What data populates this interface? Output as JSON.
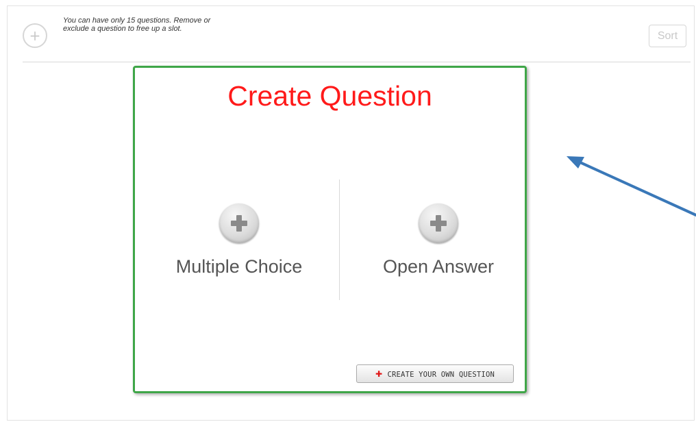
{
  "top_bar": {
    "add_icon": "plus-icon",
    "limit_message": "You can have only 15 questions. Remove or exclude a question to free up a slot.",
    "sort_label": "Sort"
  },
  "create_panel": {
    "title": "Create Question",
    "options": [
      {
        "label": "Multiple Choice",
        "icon": "plus-icon"
      },
      {
        "label": "Open Answer",
        "icon": "plus-icon"
      }
    ],
    "create_own_label": "CREATE YOUR OWN QUESTION",
    "create_own_icon": "red-plus-icon",
    "title_color": "#ff1a1a",
    "border_color": "#3fa648"
  },
  "annotation": {
    "arrow_color": "#3a78b8",
    "arrow_icon": "arrow-icon"
  }
}
